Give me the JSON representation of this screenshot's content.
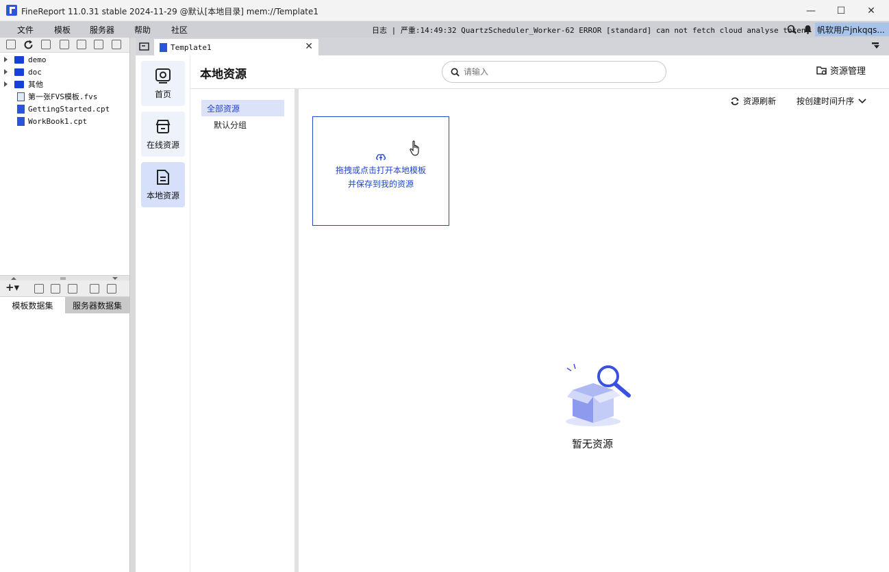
{
  "window": {
    "title": "FineReport 11.0.31 stable 2024-11-29 @默认[本地目录]    mem://Template1",
    "minimize_label": "—",
    "maximize_label": "☐",
    "close_label": "✕"
  },
  "menubar": {
    "items": [
      "文件",
      "模板",
      "服务器",
      "帮助",
      "社区"
    ],
    "log_message": "日志 | 严重:14:49:32 QuartzScheduler_Worker-62 ERROR [standard] can not fetch cloud analyse token.",
    "user": "帆软用户jnkqqs..."
  },
  "file_tree": {
    "items": [
      {
        "label": "demo",
        "type": "folder"
      },
      {
        "label": "doc",
        "type": "folder"
      },
      {
        "label": "其他",
        "type": "folder"
      },
      {
        "label": "第一张FVS模板.fvs",
        "type": "fvs"
      },
      {
        "label": "GettingStarted.cpt",
        "type": "cpt"
      },
      {
        "label": "WorkBook1.cpt",
        "type": "cpt"
      }
    ]
  },
  "dataset": {
    "tabs": [
      "模板数据集",
      "服务器数据集"
    ],
    "add_label": "+▾"
  },
  "tabs": {
    "doc_tab": "Template1",
    "close": "✕"
  },
  "nav": {
    "items": [
      {
        "label": "首页",
        "icon": "home-chart-icon"
      },
      {
        "label": "在线资源",
        "icon": "store-icon"
      },
      {
        "label": "本地资源",
        "icon": "local-file-icon"
      }
    ]
  },
  "header": {
    "title": "本地资源",
    "search_placeholder": "请输入",
    "resource_management": "资源管理"
  },
  "groups": {
    "all": "全部资源",
    "default": "默认分组"
  },
  "main": {
    "refresh": "资源刷新",
    "sort": "按创建时间升序",
    "upload_line1": "拖拽或点击打开本地模板",
    "upload_line2": "并保存到我的资源",
    "empty_text": "暂无资源"
  },
  "colors": {
    "accent": "#2146c8",
    "active_nav": "#d6e0fb",
    "menubar": "#cfd0d6"
  }
}
